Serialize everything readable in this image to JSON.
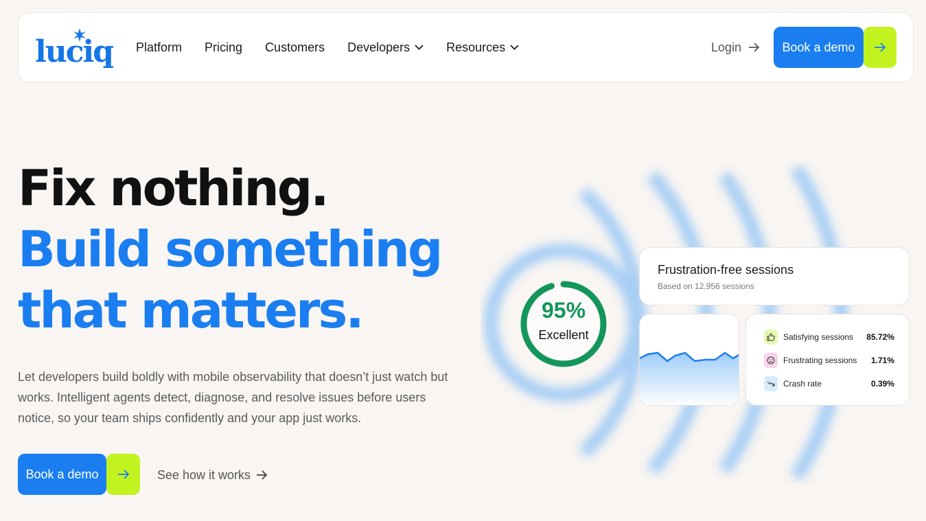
{
  "brand": {
    "name": "luciq"
  },
  "nav": {
    "links": [
      "Platform",
      "Pricing",
      "Customers",
      "Developers",
      "Resources"
    ],
    "login": "Login",
    "cta": "Book a demo"
  },
  "hero": {
    "title_line1": "Fix nothing.",
    "title_line2": "Build something",
    "title_line3": "that matters.",
    "subtitle": "Let developers build boldly with mobile observability that doesn’t just watch but works. Intelligent agents detect, diagnose, and resolve issues before users notice, so your team ships confidently and your app just works.",
    "cta": "Book a demo",
    "secondary_link": "See how it works"
  },
  "widget": {
    "score": {
      "value": "95%",
      "label": "Excellent",
      "fraction": 0.95
    },
    "card_title": "Frustration-free sessions",
    "card_subtitle": "Based on 12,956 sessions",
    "metrics": [
      {
        "label": "Satisfying sessions",
        "value": "85.72%",
        "icon": "thumbs-up-icon"
      },
      {
        "label": "Frustrating sessions",
        "value": "1.71%",
        "icon": "frown-face-icon"
      },
      {
        "label": "Crash rate",
        "value": "0.39%",
        "icon": "trend-down-icon"
      }
    ]
  },
  "colors": {
    "brand_blue": "#1a7ef0",
    "lime": "#c2f31f",
    "success_green": "#14965a",
    "background": "#f8f5f2"
  }
}
